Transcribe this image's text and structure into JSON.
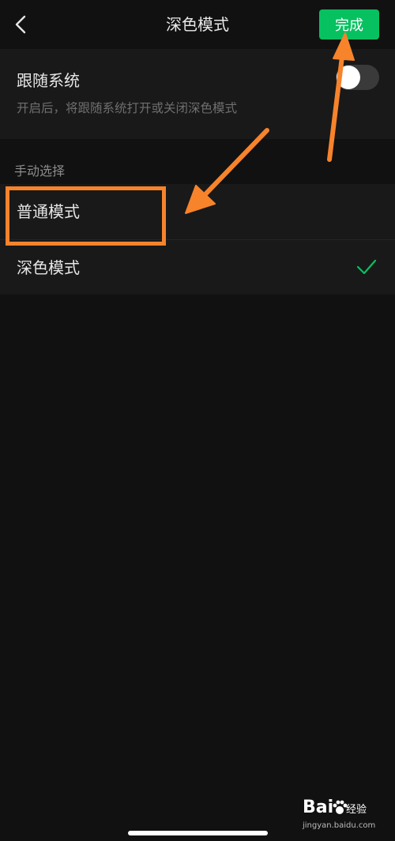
{
  "header": {
    "title": "深色模式",
    "done_label": "完成",
    "back_icon": "chevron-left-icon"
  },
  "follow_system": {
    "title": "跟随系统",
    "description": "开启后，将跟随系统打开或关闭深色模式",
    "enabled": false
  },
  "manual": {
    "section_label": "手动选择",
    "options": [
      {
        "label": "普通模式",
        "selected": false
      },
      {
        "label": "深色模式",
        "selected": true
      }
    ]
  },
  "colors": {
    "background": "#111111",
    "card": "#191919",
    "accent_green": "#07c160",
    "annotation_orange": "#f7832b"
  },
  "watermark": {
    "brand": "Bai",
    "brand_suffix": "经验",
    "url": "jingyan.baidu.com"
  }
}
